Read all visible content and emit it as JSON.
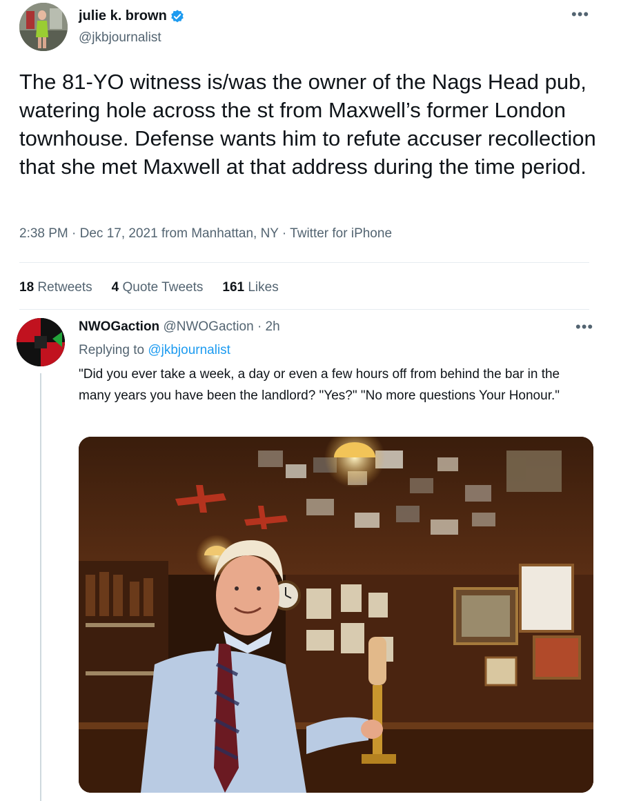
{
  "main_tweet": {
    "author_name": "julie k. brown",
    "author_handle": "@jkbjournalist",
    "verified": true,
    "text": "The 81-YO witness is/was the owner of the Nags Head pub, watering hole across the st from Maxwell’s former London townhouse. Defense wants him to refute accuser recollection that she met Maxwell at that address during the time period.",
    "timestamp": "2:38 PM · Dec 17, 2021 from Manhattan, NY · Twitter for iPhone",
    "stats": {
      "retweets_count": "18",
      "retweets_label": "Retweets",
      "quotes_count": "4",
      "quotes_label": "Quote Tweets",
      "likes_count": "161",
      "likes_label": "Likes"
    },
    "more_icon": "ellipsis-icon"
  },
  "reply": {
    "author_name": "NWOGaction",
    "author_handle": "@NWOGaction",
    "time": "· 2h",
    "replying_prefix": "Replying to",
    "replying_handle": "@jkbjournalist",
    "text": "\"Did you ever take a week, a day or even a few hours off from behind the bar in the many years you have been the landlord?  \"Yes?\" \"No more questions Your Honour.\"",
    "more_icon": "ellipsis-icon"
  },
  "colors": {
    "text_primary": "#0f1419",
    "text_secondary": "#536471",
    "link": "#1d9bf0",
    "verified_badge": "#1d9bf0",
    "divider": "#e6ecf0"
  }
}
